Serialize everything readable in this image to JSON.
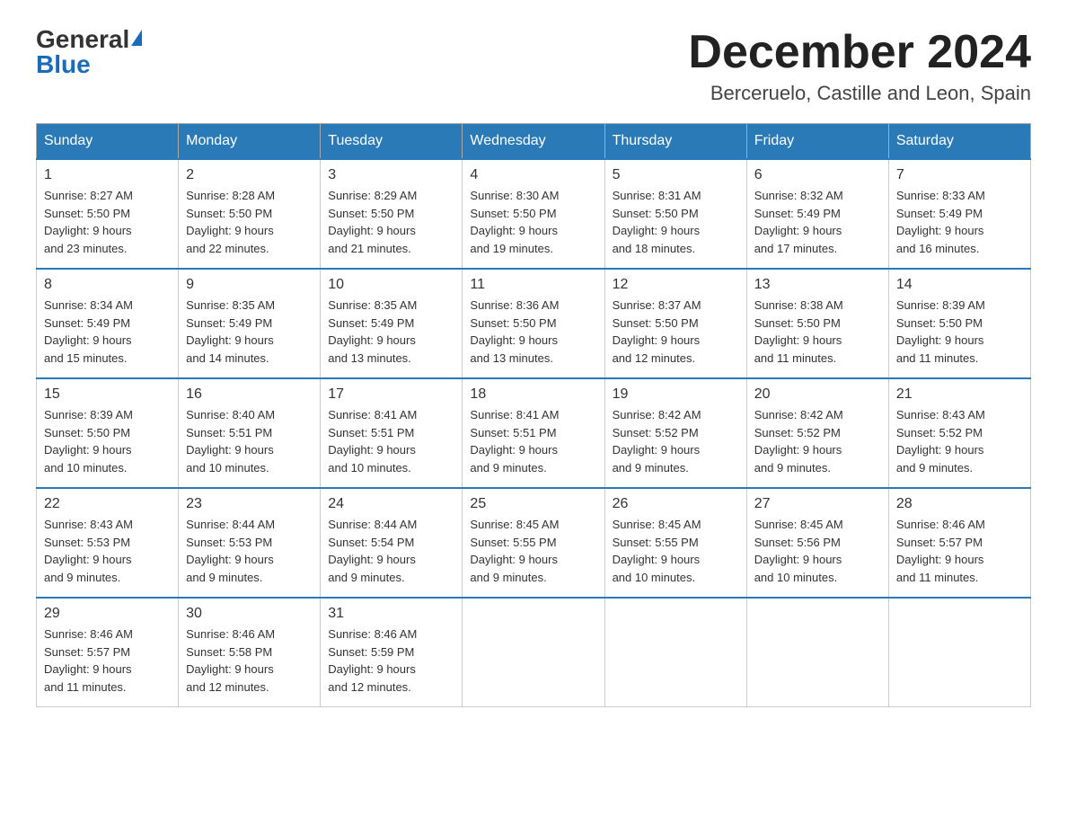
{
  "header": {
    "logo_general": "General",
    "logo_blue": "Blue",
    "month_title": "December 2024",
    "location": "Berceruelo, Castille and Leon, Spain"
  },
  "weekdays": [
    "Sunday",
    "Monday",
    "Tuesday",
    "Wednesday",
    "Thursday",
    "Friday",
    "Saturday"
  ],
  "weeks": [
    [
      {
        "day": "1",
        "sunrise": "8:27 AM",
        "sunset": "5:50 PM",
        "daylight": "9 hours and 23 minutes."
      },
      {
        "day": "2",
        "sunrise": "8:28 AM",
        "sunset": "5:50 PM",
        "daylight": "9 hours and 22 minutes."
      },
      {
        "day": "3",
        "sunrise": "8:29 AM",
        "sunset": "5:50 PM",
        "daylight": "9 hours and 21 minutes."
      },
      {
        "day": "4",
        "sunrise": "8:30 AM",
        "sunset": "5:50 PM",
        "daylight": "9 hours and 19 minutes."
      },
      {
        "day": "5",
        "sunrise": "8:31 AM",
        "sunset": "5:50 PM",
        "daylight": "9 hours and 18 minutes."
      },
      {
        "day": "6",
        "sunrise": "8:32 AM",
        "sunset": "5:49 PM",
        "daylight": "9 hours and 17 minutes."
      },
      {
        "day": "7",
        "sunrise": "8:33 AM",
        "sunset": "5:49 PM",
        "daylight": "9 hours and 16 minutes."
      }
    ],
    [
      {
        "day": "8",
        "sunrise": "8:34 AM",
        "sunset": "5:49 PM",
        "daylight": "9 hours and 15 minutes."
      },
      {
        "day": "9",
        "sunrise": "8:35 AM",
        "sunset": "5:49 PM",
        "daylight": "9 hours and 14 minutes."
      },
      {
        "day": "10",
        "sunrise": "8:35 AM",
        "sunset": "5:49 PM",
        "daylight": "9 hours and 13 minutes."
      },
      {
        "day": "11",
        "sunrise": "8:36 AM",
        "sunset": "5:50 PM",
        "daylight": "9 hours and 13 minutes."
      },
      {
        "day": "12",
        "sunrise": "8:37 AM",
        "sunset": "5:50 PM",
        "daylight": "9 hours and 12 minutes."
      },
      {
        "day": "13",
        "sunrise": "8:38 AM",
        "sunset": "5:50 PM",
        "daylight": "9 hours and 11 minutes."
      },
      {
        "day": "14",
        "sunrise": "8:39 AM",
        "sunset": "5:50 PM",
        "daylight": "9 hours and 11 minutes."
      }
    ],
    [
      {
        "day": "15",
        "sunrise": "8:39 AM",
        "sunset": "5:50 PM",
        "daylight": "9 hours and 10 minutes."
      },
      {
        "day": "16",
        "sunrise": "8:40 AM",
        "sunset": "5:51 PM",
        "daylight": "9 hours and 10 minutes."
      },
      {
        "day": "17",
        "sunrise": "8:41 AM",
        "sunset": "5:51 PM",
        "daylight": "9 hours and 10 minutes."
      },
      {
        "day": "18",
        "sunrise": "8:41 AM",
        "sunset": "5:51 PM",
        "daylight": "9 hours and 9 minutes."
      },
      {
        "day": "19",
        "sunrise": "8:42 AM",
        "sunset": "5:52 PM",
        "daylight": "9 hours and 9 minutes."
      },
      {
        "day": "20",
        "sunrise": "8:42 AM",
        "sunset": "5:52 PM",
        "daylight": "9 hours and 9 minutes."
      },
      {
        "day": "21",
        "sunrise": "8:43 AM",
        "sunset": "5:52 PM",
        "daylight": "9 hours and 9 minutes."
      }
    ],
    [
      {
        "day": "22",
        "sunrise": "8:43 AM",
        "sunset": "5:53 PM",
        "daylight": "9 hours and 9 minutes."
      },
      {
        "day": "23",
        "sunrise": "8:44 AM",
        "sunset": "5:53 PM",
        "daylight": "9 hours and 9 minutes."
      },
      {
        "day": "24",
        "sunrise": "8:44 AM",
        "sunset": "5:54 PM",
        "daylight": "9 hours and 9 minutes."
      },
      {
        "day": "25",
        "sunrise": "8:45 AM",
        "sunset": "5:55 PM",
        "daylight": "9 hours and 9 minutes."
      },
      {
        "day": "26",
        "sunrise": "8:45 AM",
        "sunset": "5:55 PM",
        "daylight": "9 hours and 10 minutes."
      },
      {
        "day": "27",
        "sunrise": "8:45 AM",
        "sunset": "5:56 PM",
        "daylight": "9 hours and 10 minutes."
      },
      {
        "day": "28",
        "sunrise": "8:46 AM",
        "sunset": "5:57 PM",
        "daylight": "9 hours and 11 minutes."
      }
    ],
    [
      {
        "day": "29",
        "sunrise": "8:46 AM",
        "sunset": "5:57 PM",
        "daylight": "9 hours and 11 minutes."
      },
      {
        "day": "30",
        "sunrise": "8:46 AM",
        "sunset": "5:58 PM",
        "daylight": "9 hours and 12 minutes."
      },
      {
        "day": "31",
        "sunrise": "8:46 AM",
        "sunset": "5:59 PM",
        "daylight": "9 hours and 12 minutes."
      },
      null,
      null,
      null,
      null
    ]
  ]
}
